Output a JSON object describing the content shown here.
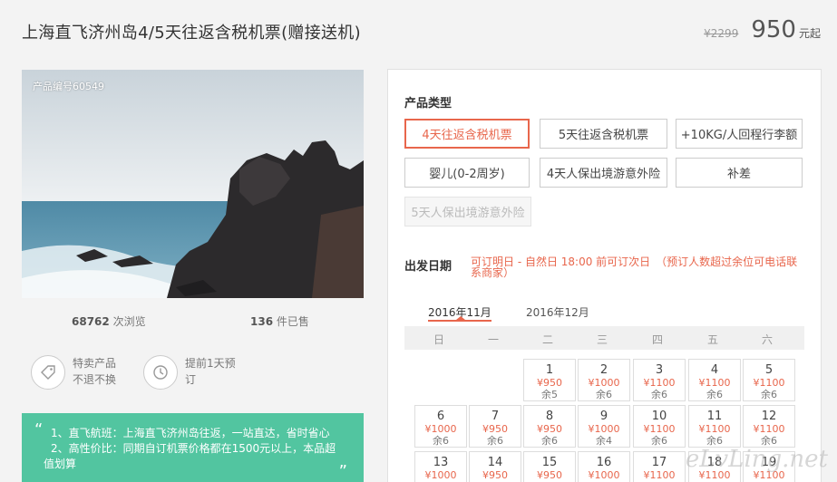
{
  "header": {
    "title": "上海直飞济州岛4/5天往返含税机票(赠接送机)",
    "old_price": "¥2299",
    "price": "950",
    "price_unit": "元起"
  },
  "gallery": {
    "product_no": "产品编号60549"
  },
  "stats": {
    "views_count": "68762",
    "views_label": "次浏览",
    "sold_count": "136",
    "sold_label": "件已售"
  },
  "features": [
    {
      "icon": "tag-icon",
      "line1": "特卖产品",
      "line2": "不退不换"
    },
    {
      "icon": "clock-icon",
      "line1": "提前1天预",
      "line2": "订"
    }
  ],
  "highlights": {
    "line1": "1、直飞航班：上海直飞济州岛往返，一站直达，省时省心",
    "line2": "2、高性价比：同期自订机票价格都在1500元以上，本品超",
    "line3": "值划算"
  },
  "booking": {
    "type_label": "产品类型",
    "types": [
      {
        "label": "4天往返含税机票",
        "state": "selected"
      },
      {
        "label": "5天往返含税机票",
        "state": "normal"
      },
      {
        "label": "+10KG/人回程行李额",
        "state": "normal"
      },
      {
        "label": "婴儿(0-2周岁)",
        "state": "normal"
      },
      {
        "label": "4天人保出境游意外险",
        "state": "normal"
      },
      {
        "label": "补差",
        "state": "normal"
      },
      {
        "label": "5天人保出境游意外险",
        "state": "disabled"
      }
    ],
    "date_label": "出发日期",
    "date_note": "可订明日 - 自然日 18:00 前可订次日　（预订人数超过余位可电话联系商家）",
    "months": [
      "2016年11月",
      "2016年12月"
    ],
    "weekdays": [
      "日",
      "一",
      "二",
      "三",
      "四",
      "五",
      "六"
    ],
    "days": [
      {
        "day": "1",
        "price": "¥950",
        "remain": "余5"
      },
      {
        "day": "2",
        "price": "¥1000",
        "remain": "余6"
      },
      {
        "day": "3",
        "price": "¥1100",
        "remain": "余6"
      },
      {
        "day": "4",
        "price": "¥1100",
        "remain": "余6"
      },
      {
        "day": "5",
        "price": "¥1100",
        "remain": "余6"
      },
      {
        "day": "6",
        "price": "¥1000",
        "remain": "余6"
      },
      {
        "day": "7",
        "price": "¥950",
        "remain": "余6"
      },
      {
        "day": "8",
        "price": "¥950",
        "remain": "余6"
      },
      {
        "day": "9",
        "price": "¥1000",
        "remain": "余4"
      },
      {
        "day": "10",
        "price": "¥1100",
        "remain": "余6"
      },
      {
        "day": "11",
        "price": "¥1100",
        "remain": "余6"
      },
      {
        "day": "12",
        "price": "¥1100",
        "remain": "余6"
      },
      {
        "day": "13",
        "price": "¥1000",
        "remain": ""
      },
      {
        "day": "14",
        "price": "¥950",
        "remain": ""
      },
      {
        "day": "15",
        "price": "¥950",
        "remain": ""
      },
      {
        "day": "16",
        "price": "¥1000",
        "remain": ""
      },
      {
        "day": "17",
        "price": "¥1100",
        "remain": ""
      },
      {
        "day": "18",
        "price": "¥1100",
        "remain": ""
      },
      {
        "day": "19",
        "price": "¥1100",
        "remain": ""
      }
    ]
  },
  "watermark": "eLvLing.net",
  "colors": {
    "accent": "#e8664c",
    "highlight_bg": "#52c5a0"
  }
}
